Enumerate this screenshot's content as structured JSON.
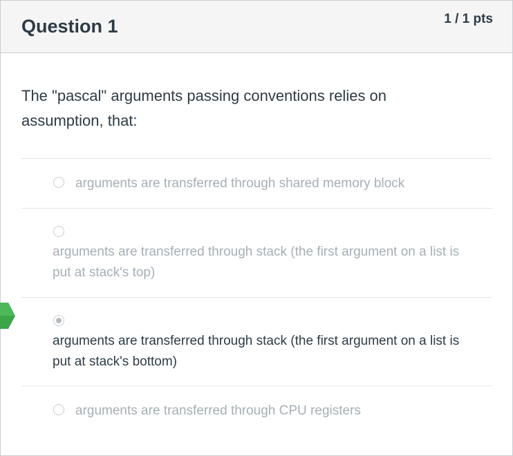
{
  "question": {
    "title": "Question 1",
    "points": "1 / 1 pts",
    "text": "The \"pascal\" arguments passing conventions relies on assumption, that:"
  },
  "answers": [
    {
      "label": "arguments are transferred through shared memory block",
      "selected": false
    },
    {
      "label": "arguments are transferred through stack (the first argument on a list is put at stack's top)",
      "selected": false
    },
    {
      "label": "arguments are transferred through stack (the first argument on a list is put at stack's bottom)",
      "selected": true
    },
    {
      "label": "arguments are transferred through CPU registers",
      "selected": false
    }
  ],
  "colors": {
    "correct_marker": "#3aa648",
    "text": "#2d3b45",
    "muted_text": "#a5afb5",
    "header_bg": "#f5f5f5",
    "border": "#c7cdd1"
  },
  "icons": {
    "correct_marker": "correct-answer-arrow-icon"
  }
}
